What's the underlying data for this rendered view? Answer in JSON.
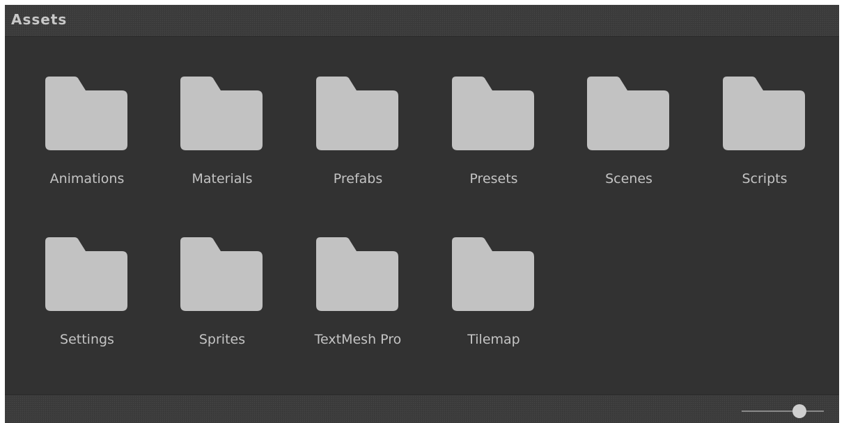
{
  "header": {
    "title": "Assets"
  },
  "folders": [
    {
      "label": "Animations",
      "icon": "folder-icon"
    },
    {
      "label": "Materials",
      "icon": "folder-icon"
    },
    {
      "label": "Prefabs",
      "icon": "folder-icon"
    },
    {
      "label": "Presets",
      "icon": "folder-icon"
    },
    {
      "label": "Scenes",
      "icon": "folder-icon"
    },
    {
      "label": "Scripts",
      "icon": "folder-icon"
    },
    {
      "label": "Settings",
      "icon": "folder-icon"
    },
    {
      "label": "Sprites",
      "icon": "folder-icon"
    },
    {
      "label": "TextMesh Pro",
      "icon": "folder-icon"
    },
    {
      "label": "Tilemap",
      "icon": "folder-icon"
    }
  ],
  "footer": {
    "zoom_level": 0.7
  },
  "colors": {
    "panel_background": "#323232",
    "bar_background": "#3c3c3c",
    "folder_fill": "#c2c2c2",
    "label_text": "#c4c4c4"
  }
}
